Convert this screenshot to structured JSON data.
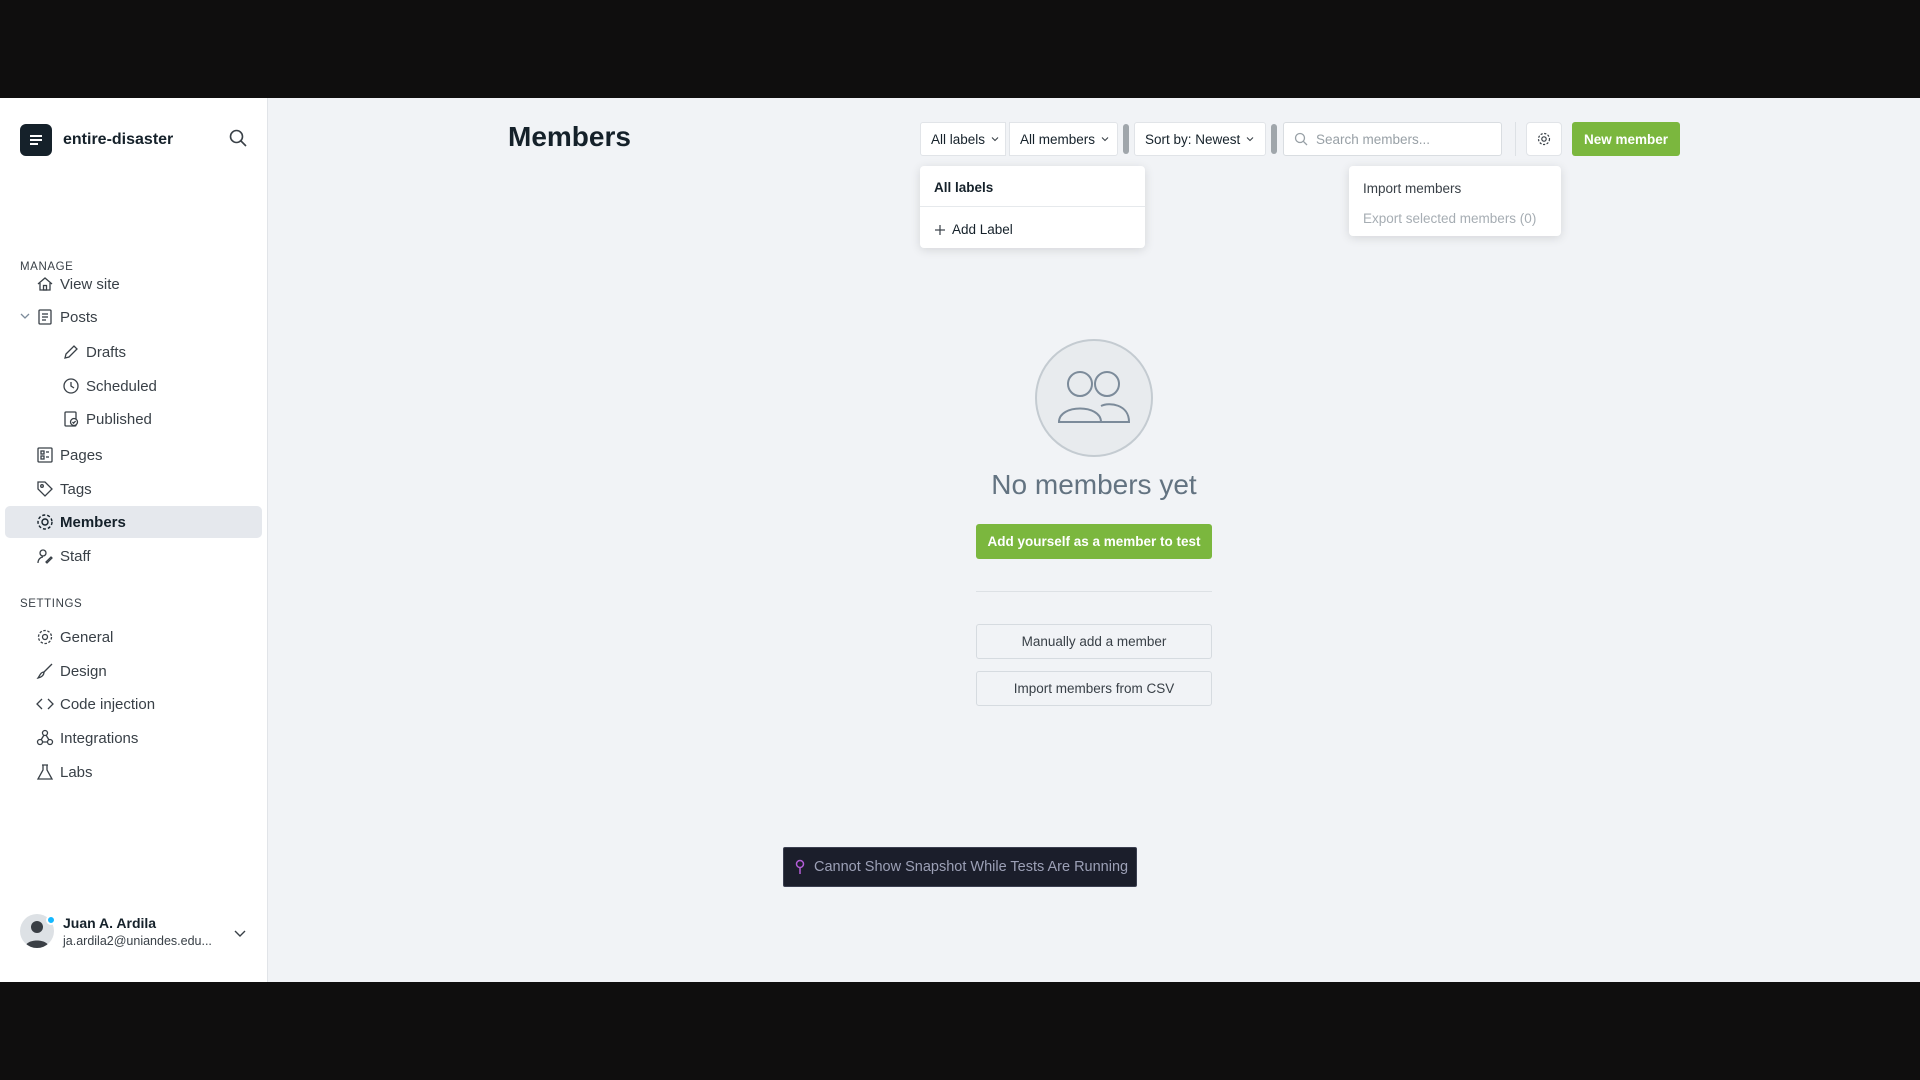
{
  "sidebar": {
    "site_name": "entire-disaster",
    "view_site": "View site",
    "manage_title": "MANAGE",
    "settings_title": "SETTINGS",
    "items": {
      "posts": "Posts",
      "drafts": "Drafts",
      "scheduled": "Scheduled",
      "published": "Published",
      "pages": "Pages",
      "tags": "Tags",
      "members": "Members",
      "staff": "Staff",
      "general": "General",
      "design": "Design",
      "code_injection": "Code injection",
      "integrations": "Integrations",
      "labs": "Labs"
    },
    "user": {
      "name": "Juan A. Ardila",
      "email": "ja.ardila2@uniandes.edu..."
    }
  },
  "header": {
    "title": "Members",
    "filter_labels": "All labels",
    "filter_members": "All members",
    "sort": "Sort by: Newest",
    "search_placeholder": "Search members...",
    "new_member": "New member"
  },
  "labels_dropdown": {
    "heading": "All labels",
    "add_label": "Add Label"
  },
  "actions_dropdown": {
    "import": "Import members",
    "export": "Export selected members (0)"
  },
  "empty_state": {
    "title": "No members yet",
    "add_self": "Add yourself as a member to test",
    "manual_add": "Manually add a member",
    "import_csv": "Import members from CSV"
  },
  "toast": {
    "message": "Cannot Show Snapshot While Tests Are Running"
  },
  "colors": {
    "accent_green": "#7bb73e",
    "sidebar_active": "#e5e8ed",
    "page_bg": "#f1f3f6"
  }
}
